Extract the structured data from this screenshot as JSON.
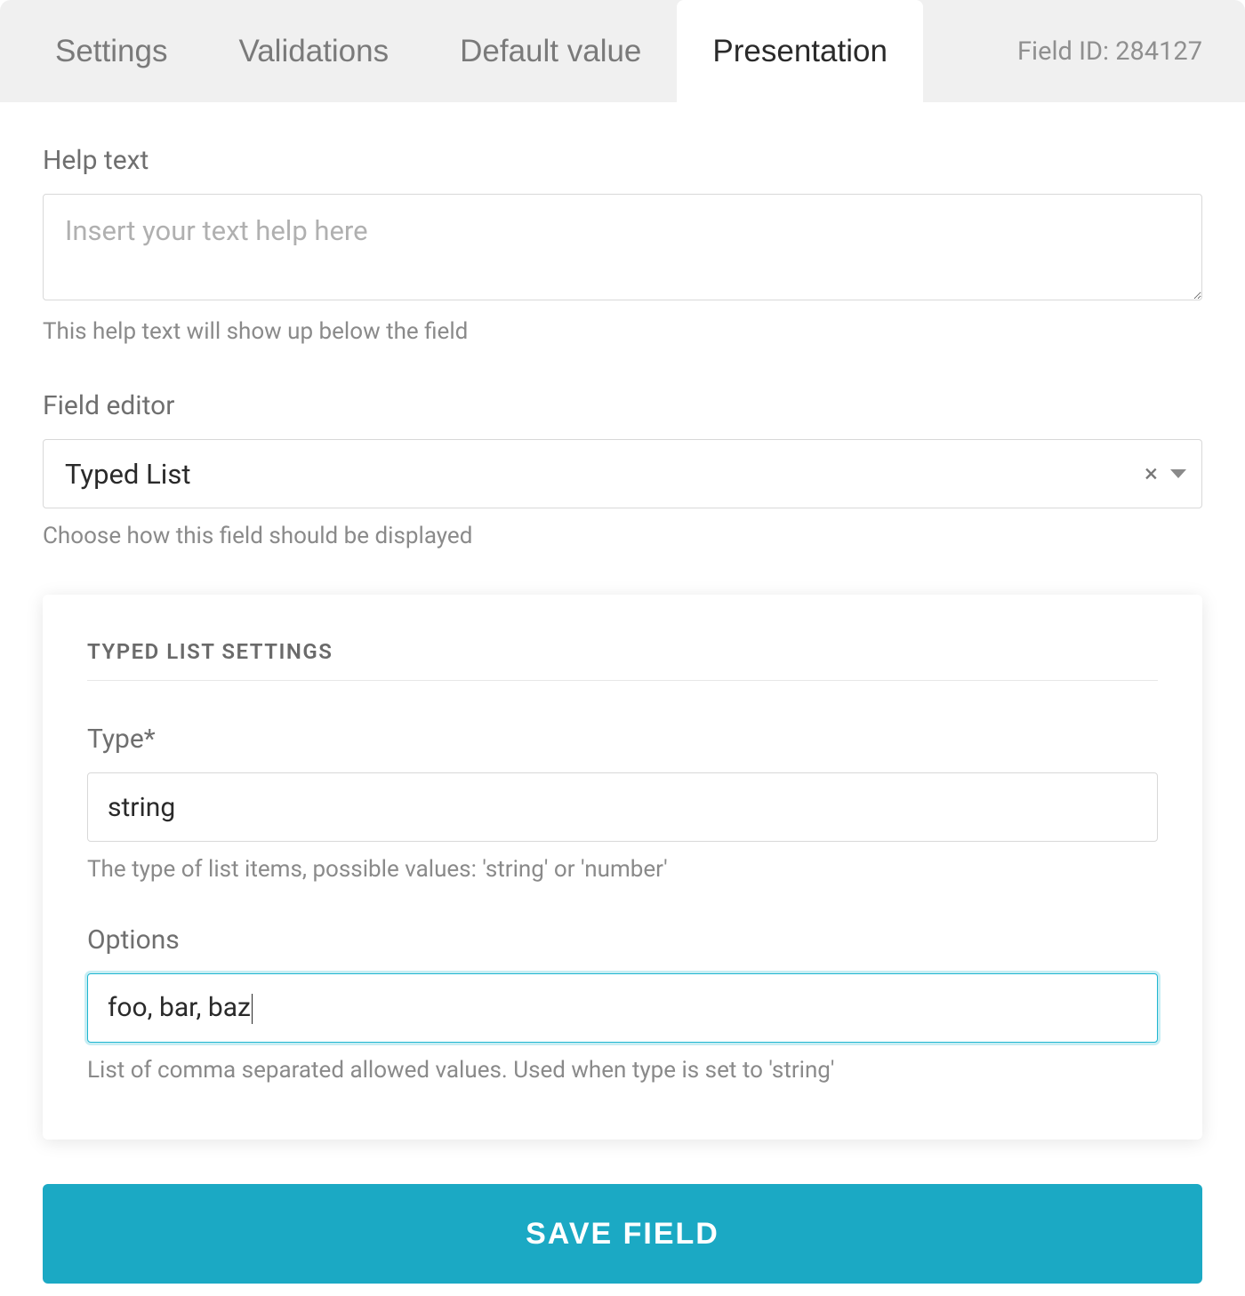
{
  "tabs": {
    "settings": "Settings",
    "validations": "Validations",
    "default_value": "Default value",
    "presentation": "Presentation"
  },
  "field_id_label": "Field ID: 284127",
  "help_text": {
    "label": "Help text",
    "placeholder": "Insert your text help here",
    "value": "",
    "hint": "This help text will show up below the field"
  },
  "field_editor": {
    "label": "Field editor",
    "value": "Typed List",
    "hint": "Choose how this field should be displayed"
  },
  "typed_list_panel": {
    "title": "TYPED LIST SETTINGS",
    "type": {
      "label": "Type*",
      "value": "string",
      "hint": "The type of list items, possible values: 'string' or 'number'"
    },
    "options": {
      "label": "Options",
      "value": "foo, bar, baz",
      "hint": "List of comma separated allowed values. Used when type is set to 'string'"
    }
  },
  "save_button": "SAVE FIELD"
}
